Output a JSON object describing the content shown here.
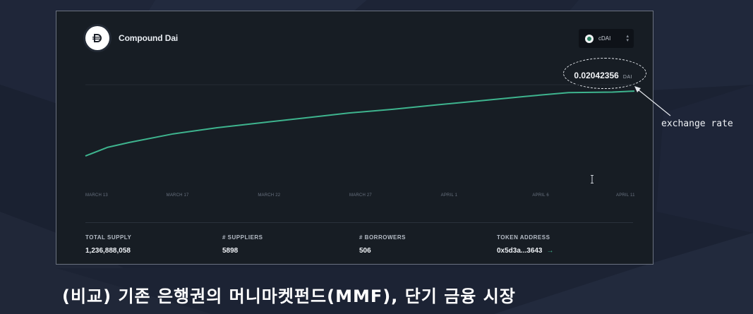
{
  "app": {
    "title": "Compound Dai",
    "token_select": {
      "selected": "cDAI"
    }
  },
  "rate": {
    "value": "0.02042356",
    "unit": "DAI"
  },
  "annotation": {
    "text": "exchange rate"
  },
  "caption": {
    "text": "(비교) 기존 은행권의 머니마켓펀드(MMF), 단기 금융 시장"
  },
  "stats": [
    {
      "label": "TOTAL SUPPLY",
      "value": "1,236,888,058"
    },
    {
      "label": "# SUPPLIERS",
      "value": "5898"
    },
    {
      "label": "# BORROWERS",
      "value": "506"
    },
    {
      "label": "TOKEN ADDRESS",
      "value": "0x5d3a...3643"
    }
  ],
  "colors": {
    "line": "#3eb48e",
    "card_bg": "#171d24",
    "page_bg": "#1b2233",
    "accent_arrow": "#3fb08a"
  },
  "icons": {
    "logo": "dai-logo-icon",
    "select_chevron": "updown-chevron-icon",
    "address_link": "arrow-right-icon",
    "cursor": "text-cursor-icon"
  },
  "chart_data": {
    "type": "line",
    "ylabel": "",
    "xlabel": "",
    "x_tick_labels": [
      "MARCH 13",
      "MARCH 17",
      "MARCH 22",
      "MARCH 27",
      "APRIL 1",
      "APRIL 6",
      "APRIL 11"
    ],
    "x": [
      0,
      2,
      4,
      8,
      12,
      16,
      20,
      24,
      28,
      32,
      36,
      40,
      44,
      48,
      50
    ],
    "series": [
      {
        "values": [
          0.02016,
          0.020195,
          0.020215,
          0.02025,
          0.020275,
          0.020295,
          0.020315,
          0.020335,
          0.02035,
          0.020368,
          0.020385,
          0.020402,
          0.020418,
          0.02042,
          0.020424
        ]
      }
    ],
    "ylim": [
      0.0201,
      0.02045
    ],
    "xlim": [
      0,
      50
    ],
    "grid": false
  }
}
